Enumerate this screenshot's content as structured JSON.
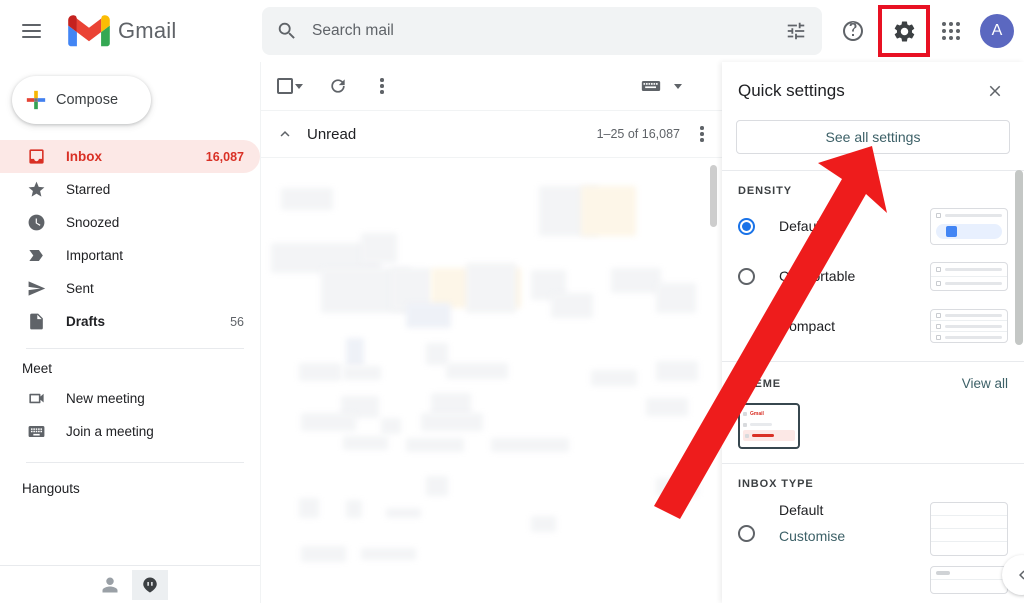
{
  "topbar": {
    "menu_icon": "hamburger-icon",
    "logo_icon": "gmail-logo-icon",
    "brand": "Gmail",
    "search": {
      "icon": "search-icon",
      "placeholder": "Search mail",
      "value": "",
      "options_icon": "tune-icon"
    },
    "help_icon": "help-icon",
    "settings_icon": "gear-icon",
    "apps_icon": "apps-grid-icon",
    "avatar_letter": "A",
    "highlight_color": "#e81123"
  },
  "sidebar": {
    "compose": {
      "label": "Compose",
      "icon": "plus-icon"
    },
    "items": [
      {
        "label": "Inbox",
        "icon": "inbox-icon",
        "count": "16,087",
        "active": true
      },
      {
        "label": "Starred",
        "icon": "star-icon",
        "count": "",
        "active": false
      },
      {
        "label": "Snoozed",
        "icon": "clock-icon",
        "count": "",
        "active": false
      },
      {
        "label": "Important",
        "icon": "important-label-icon",
        "count": "",
        "active": false
      },
      {
        "label": "Sent",
        "icon": "send-icon",
        "count": "",
        "active": false
      },
      {
        "label": "Drafts",
        "icon": "draft-file-icon",
        "count": "56",
        "active": false
      }
    ],
    "meet": {
      "title": "Meet",
      "items": [
        {
          "label": "New meeting",
          "icon": "video-camera-icon"
        },
        {
          "label": "Join a meeting",
          "icon": "keyboard-icon"
        }
      ]
    },
    "hangouts": {
      "title": "Hangouts"
    },
    "footer": {
      "contacts_icon": "person-icon",
      "chat_icon": "hangouts-chat-icon"
    }
  },
  "maillist": {
    "toolbar": {
      "select_all_icon": "checkbox-icon",
      "select_dropdown_icon": "chevron-down-icon",
      "refresh_icon": "refresh-icon",
      "more_icon": "more-vertical-icon",
      "input_tools_icon": "keyboard-icon",
      "input_tools_dropdown_icon": "chevron-down-icon"
    },
    "header": {
      "collapse_icon": "chevron-up-icon",
      "title": "Unread",
      "range": "1–25 of 16,087",
      "more_icon": "more-vertical-icon"
    }
  },
  "quick_settings": {
    "title": "Quick settings",
    "close_icon": "close-icon",
    "see_all_settings": "See all settings",
    "density": {
      "title": "DENSITY",
      "options": [
        {
          "label": "Default",
          "selected": true
        },
        {
          "label": "Comfortable",
          "selected": false
        },
        {
          "label": "Compact",
          "selected": false
        }
      ]
    },
    "theme": {
      "title": "THEME",
      "view_all": "View all",
      "thumb_brand": "Gmail"
    },
    "inbox_type": {
      "title": "INBOX TYPE",
      "default_label": "Default",
      "customise_label": "Customise",
      "selected": false
    },
    "collapse_icon": "chevron-left-icon",
    "accent_color": "#1a73e8"
  },
  "annotation": {
    "arrow_color": "#ee1c1c",
    "arrow_target": "See all settings"
  }
}
